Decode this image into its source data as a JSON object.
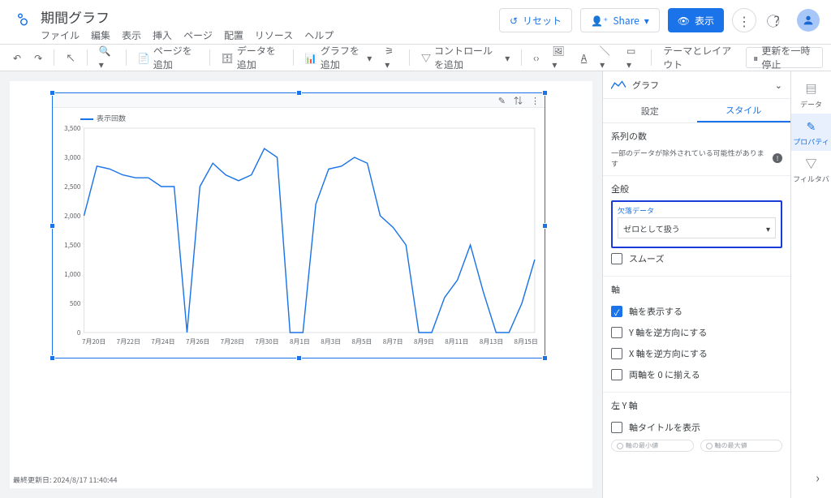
{
  "app": {
    "title": "期間グラフ",
    "menu": [
      "ファイル",
      "編集",
      "表示",
      "挿入",
      "ページ",
      "配置",
      "リソース",
      "ヘルプ"
    ]
  },
  "topbar": {
    "reset": "リセット",
    "share": "Share",
    "view": "表示"
  },
  "toolbar": {
    "add_page": "ページを追加",
    "add_data": "データを追加",
    "add_chart": "グラフを追加",
    "add_control": "コントロールを追加",
    "theme_layout": "テーマとレイアウト",
    "pause_refresh": "更新を一時停止"
  },
  "chart_data": {
    "type": "line",
    "legend": "表示回数",
    "xlabel": "",
    "ylabel": "",
    "ylim": [
      0,
      3500
    ],
    "yticks": [
      0,
      500,
      1000,
      1500,
      2000,
      2500,
      3000,
      3500
    ],
    "categories": [
      "7月20日",
      "7月22日",
      "7月24日",
      "7月26日",
      "7月28日",
      "7月30日",
      "8月1日",
      "8月3日",
      "8月5日",
      "8月7日",
      "8月9日",
      "8月11日",
      "8月13日",
      "8月15日"
    ],
    "values_daily": [
      2000,
      2850,
      2800,
      2700,
      2650,
      2650,
      2500,
      2500,
      0,
      2500,
      2900,
      2700,
      2600,
      2700,
      3150,
      3000,
      0,
      0,
      2200,
      2800,
      2850,
      3000,
      2900,
      2000,
      1800,
      1500,
      0,
      0,
      600,
      900,
      1500,
      700,
      0,
      0,
      500,
      1250
    ],
    "series": [
      {
        "name": "表示回数",
        "values": [
          2000,
          2850,
          2800,
          2700,
          2650,
          2650,
          2500,
          2500,
          0,
          2500,
          2900,
          2700,
          2600,
          2700,
          3150,
          3000,
          0,
          0,
          2200,
          2800,
          2850,
          3000,
          2900,
          2000,
          1800,
          1500,
          0,
          0,
          600,
          900,
          1500,
          700,
          0,
          0,
          500,
          1250
        ]
      }
    ]
  },
  "footer": {
    "last_update": "最終更新日: 2024/8/17 11:40:44"
  },
  "panel": {
    "title": "グラフ",
    "tabs": {
      "settings": "設定",
      "style": "スタイル"
    },
    "series_count": {
      "title": "系列の数",
      "hint": "一部のデータが除外されている可能性があります"
    },
    "general": {
      "title": "全般",
      "missing_label": "欠落データ",
      "missing_value": "ゼロとして扱う",
      "smooth": "スムーズ"
    },
    "axis": {
      "title": "軸",
      "show": "軸を表示する",
      "y_reverse": "Y 軸を逆方向にする",
      "x_reverse": "X 軸を逆方向にする",
      "align_zero": "両軸を 0 に揃える"
    },
    "left_y": {
      "title": "左 Y 軸",
      "show_title": "軸タイトルを表示",
      "min": "軸の最小値",
      "max": "軸の最大値"
    }
  },
  "rail": {
    "data": "データ",
    "properties": "プロパティ",
    "filter": "フィルタバ"
  }
}
